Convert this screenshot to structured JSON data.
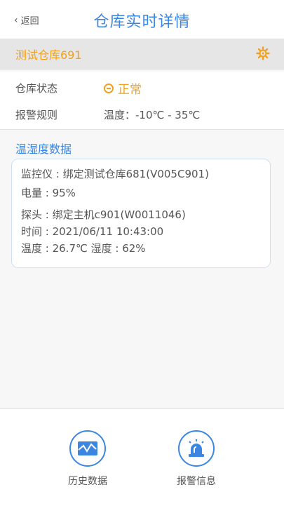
{
  "header": {
    "back_label": "返回",
    "title": "仓库实时详情"
  },
  "warehouse": {
    "name": "测试仓库691",
    "settings_icon": "gear-icon"
  },
  "info_rows": {
    "status_label": "仓库状态",
    "status_value": "正常",
    "rule_label": "报警规则",
    "rule_value": "温度：-10℃ - 35℃"
  },
  "section": {
    "title": "温湿度数据"
  },
  "monitor": {
    "monitor_line": "监控仪 : 绑定测试仓库681(V005C901)",
    "battery_line": "电量 : 95%",
    "probe_line": "探头 : 绑定主机c901(W0011046)",
    "time_line": "时间 : 2021/06/11 10:43:00",
    "reading_line": "温度 : 26.7℃  湿度 : 62%"
  },
  "bottom_nav": {
    "history_label": "历史数据",
    "alarm_label": "报警信息"
  },
  "colors": {
    "accent": "#3b86e0",
    "warning": "#f0a01e"
  }
}
